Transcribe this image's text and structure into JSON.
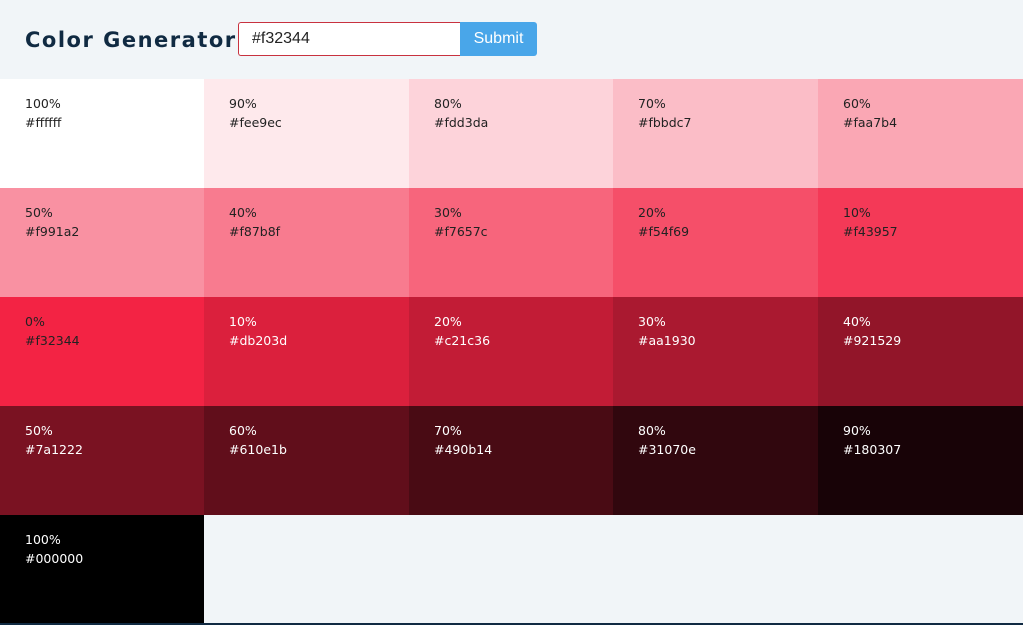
{
  "app": {
    "title": "Color Generator"
  },
  "form": {
    "input_value": "#f32344",
    "submit_label": "Submit"
  },
  "swatches": [
    {
      "percent": "100%",
      "hex": "#ffffff",
      "tone": "light"
    },
    {
      "percent": "90%",
      "hex": "#fee9ec",
      "tone": "light"
    },
    {
      "percent": "80%",
      "hex": "#fdd3da",
      "tone": "light"
    },
    {
      "percent": "70%",
      "hex": "#fbbdc7",
      "tone": "light"
    },
    {
      "percent": "60%",
      "hex": "#faa7b4",
      "tone": "light"
    },
    {
      "percent": "50%",
      "hex": "#f991a2",
      "tone": "light"
    },
    {
      "percent": "40%",
      "hex": "#f87b8f",
      "tone": "light"
    },
    {
      "percent": "30%",
      "hex": "#f7657c",
      "tone": "light"
    },
    {
      "percent": "20%",
      "hex": "#f54f69",
      "tone": "light"
    },
    {
      "percent": "10%",
      "hex": "#f43957",
      "tone": "light"
    },
    {
      "percent": "0%",
      "hex": "#f32344",
      "tone": "light"
    },
    {
      "percent": "10%",
      "hex": "#db203d",
      "tone": "dark"
    },
    {
      "percent": "20%",
      "hex": "#c21c36",
      "tone": "dark"
    },
    {
      "percent": "30%",
      "hex": "#aa1930",
      "tone": "dark"
    },
    {
      "percent": "40%",
      "hex": "#921529",
      "tone": "dark"
    },
    {
      "percent": "50%",
      "hex": "#7a1222",
      "tone": "dark"
    },
    {
      "percent": "60%",
      "hex": "#610e1b",
      "tone": "dark"
    },
    {
      "percent": "70%",
      "hex": "#490b14",
      "tone": "dark"
    },
    {
      "percent": "80%",
      "hex": "#31070e",
      "tone": "dark"
    },
    {
      "percent": "90%",
      "hex": "#180307",
      "tone": "dark"
    },
    {
      "percent": "100%",
      "hex": "#000000",
      "tone": "dark"
    }
  ]
}
